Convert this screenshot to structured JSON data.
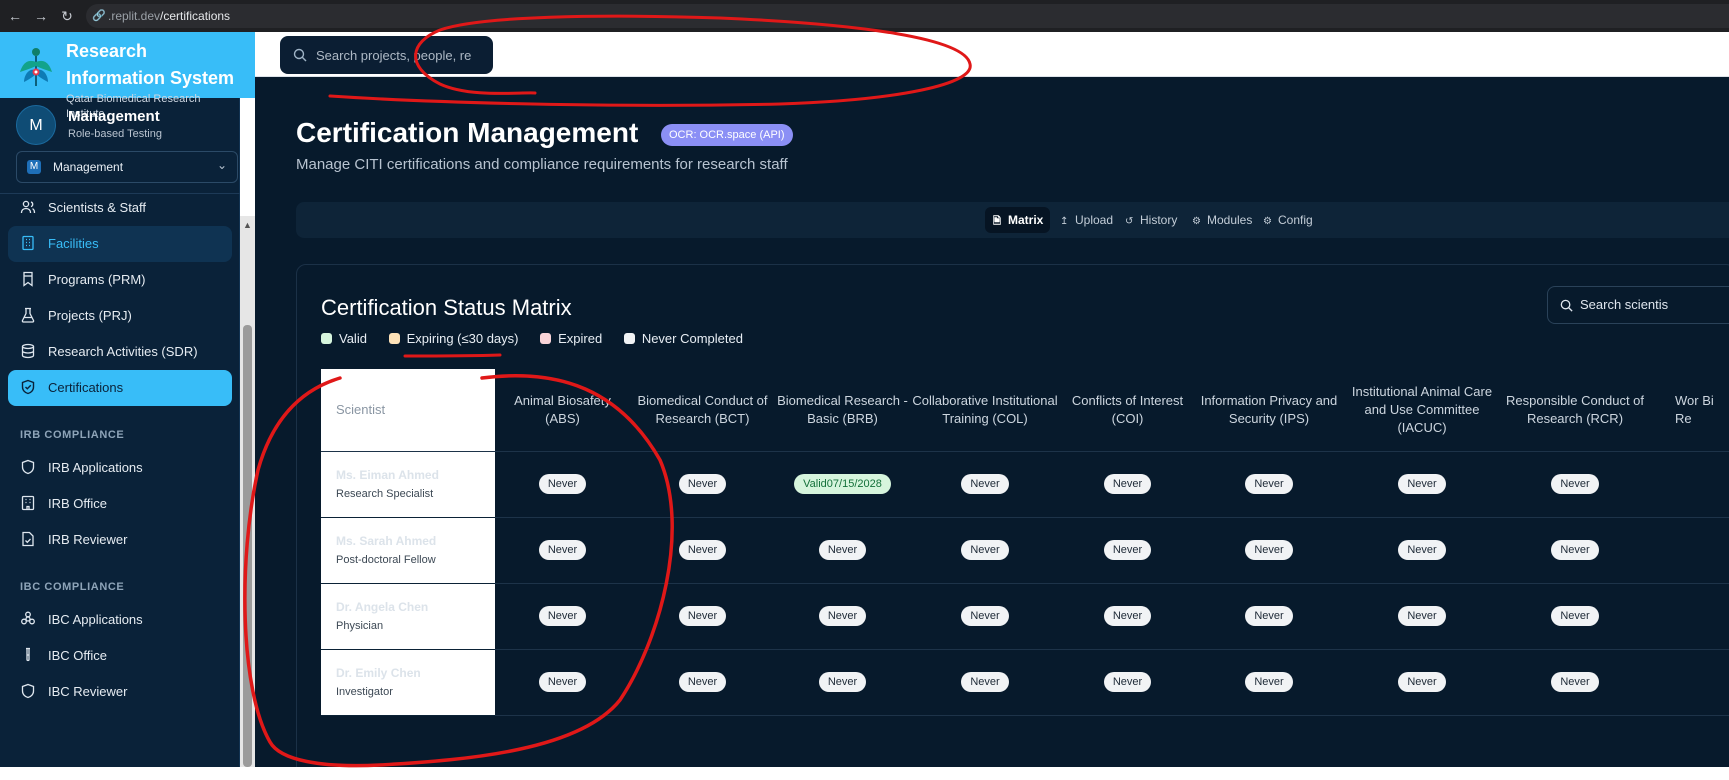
{
  "browser": {
    "url_prefix": ".replit.dev",
    "url_path": "/certifications"
  },
  "sidebar": {
    "brand_title": "Research Information System",
    "brand_subtitle": "Qatar Biomedical Research Institute",
    "user": {
      "initial": "M",
      "name": "Management",
      "role": "Role-based Testing"
    },
    "role_select": {
      "badge": "M",
      "value": "Management"
    },
    "items": [
      {
        "label": "Scientists & Staff",
        "icon": "users-icon"
      },
      {
        "label": "Facilities",
        "icon": "building-icon"
      },
      {
        "label": "Programs (PRM)",
        "icon": "bookmark-icon"
      },
      {
        "label": "Projects (PRJ)",
        "icon": "flask-icon"
      },
      {
        "label": "Research Activities (SDR)",
        "icon": "database-icon"
      },
      {
        "label": "Certifications",
        "icon": "shield-check-icon"
      }
    ],
    "irb_header": "IRB COMPLIANCE",
    "irb_items": [
      {
        "label": "IRB Applications",
        "icon": "shield-icon"
      },
      {
        "label": "IRB Office",
        "icon": "office-building-icon"
      },
      {
        "label": "IRB Reviewer",
        "icon": "file-check-icon"
      }
    ],
    "ibc_header": "IBC COMPLIANCE",
    "ibc_items": [
      {
        "label": "IBC Applications",
        "icon": "biohazard-icon"
      },
      {
        "label": "IBC Office",
        "icon": "test-tube-icon"
      },
      {
        "label": "IBC Reviewer",
        "icon": "shield-icon"
      }
    ]
  },
  "topbar": {
    "search_placeholder": "Search projects, people, re"
  },
  "page": {
    "title": "Certification Management",
    "ocr_badge": "OCR: OCR.space (API)",
    "subtitle": "Manage CITI certifications and compliance requirements for research staff",
    "tabs": [
      {
        "label": "Matrix",
        "icon": "file-icon",
        "active": true
      },
      {
        "label": "Upload",
        "icon": "upload-icon",
        "active": false
      },
      {
        "label": "History",
        "icon": "history-icon",
        "active": false
      },
      {
        "label": "Modules",
        "icon": "gear-icon",
        "active": false
      },
      {
        "label": "Config",
        "icon": "gear-icon",
        "active": false
      }
    ]
  },
  "matrix": {
    "title": "Certification Status Matrix",
    "search_placeholder": "Search scientis",
    "legend": [
      {
        "label": "Valid",
        "color": "#d6f5dd"
      },
      {
        "label": "Expiring (≤30 days)",
        "color": "#fde2b8"
      },
      {
        "label": "Expired",
        "color": "#f9d4d8"
      },
      {
        "label": "Never Completed",
        "color": "#f1f3f5"
      }
    ],
    "scientist_header": "Scientist",
    "columns": [
      "Animal Biosafety (ABS)",
      "Biomedical Conduct of Research (BCT)",
      "Biomedical Research - Basic (BRB)",
      "Collaborative Institutional Training (COL)",
      "Conflicts of Interest (COI)",
      "Information Privacy and Security (IPS)",
      "Institutional Animal Care and Use Committee (IACUC)",
      "Responsible Conduct of Research (RCR)",
      "Wor Bi Re"
    ],
    "rows": [
      {
        "name": "Ms. Eiman Ahmed",
        "title": "Research Specialist",
        "status": [
          "Never",
          "Never",
          "Valid",
          "Never",
          "Never",
          "Never",
          "Never",
          "Never"
        ],
        "date": [
          "",
          "",
          "07/15/2028",
          "",
          "",
          "",
          "",
          ""
        ]
      },
      {
        "name": "Ms. Sarah Ahmed",
        "title": "Post-doctoral Fellow",
        "status": [
          "Never",
          "Never",
          "Never",
          "Never",
          "Never",
          "Never",
          "Never",
          "Never"
        ],
        "date": [
          "",
          "",
          "",
          "",
          "",
          "",
          "",
          ""
        ]
      },
      {
        "name": "Dr. Angela Chen",
        "title": "Physician",
        "status": [
          "Never",
          "Never",
          "Never",
          "Never",
          "Never",
          "Never",
          "Never",
          "Never"
        ],
        "date": [
          "",
          "",
          "",
          "",
          "",
          "",
          "",
          ""
        ]
      },
      {
        "name": "Dr. Emily Chen",
        "title": "Investigator",
        "status": [
          "Never",
          "Never",
          "Never",
          "Never",
          "Never",
          "Never",
          "Never",
          "Never"
        ],
        "date": [
          "",
          "",
          "",
          "",
          "",
          "",
          "",
          ""
        ]
      }
    ]
  },
  "annotation": {
    "color": "#e01818"
  }
}
